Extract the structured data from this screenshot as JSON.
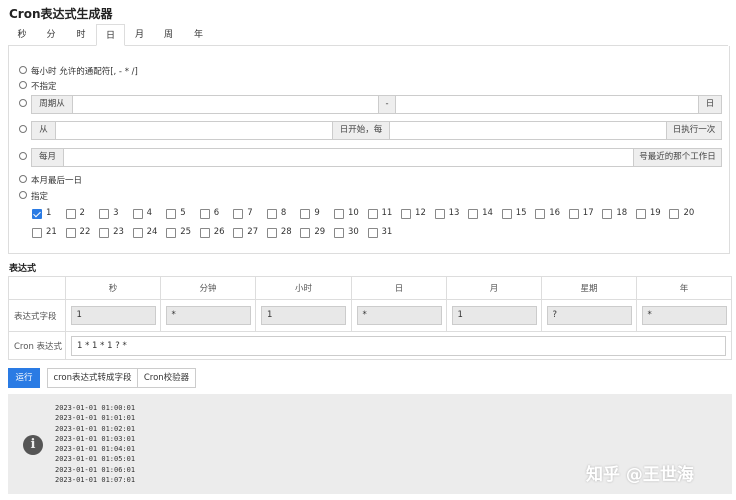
{
  "app_title": "Cron表达式生成器",
  "tabs": [
    "秒",
    "分",
    "时",
    "日",
    "月",
    "周",
    "年"
  ],
  "active_tab": "日",
  "day_options": {
    "every": "每小时 允许的通配符[, - * /]",
    "unspecified": "不指定",
    "period": {
      "prefix": "周期从",
      "separator": "-",
      "suffix": "日"
    },
    "from": {
      "prefix": "从",
      "middle": "日开始，每",
      "suffix": "日执行一次"
    },
    "monthly": {
      "prefix": "每月",
      "suffix": "号最近的那个工作日"
    },
    "last_day": "本月最后一日",
    "specify": "指定"
  },
  "days": [
    "1",
    "2",
    "3",
    "4",
    "5",
    "6",
    "7",
    "8",
    "9",
    "10",
    "11",
    "12",
    "13",
    "14",
    "15",
    "16",
    "17",
    "18",
    "19",
    "20",
    "21",
    "22",
    "23",
    "24",
    "25",
    "26",
    "27",
    "28",
    "29",
    "30",
    "31"
  ],
  "checked_days": [
    "1"
  ],
  "expression": {
    "section_title": "表达式",
    "columns": [
      "秒",
      "分钟",
      "小时",
      "日",
      "月",
      "星期",
      "年"
    ],
    "field_row_label": "表达式字段",
    "field_values": [
      "1",
      "*",
      "1",
      "*",
      "1",
      "?",
      "*"
    ],
    "cron_row_label": "Cron 表达式",
    "cron_value": "1 * 1 * 1 ? *"
  },
  "buttons": {
    "run": "运行",
    "to_fields": "cron表达式转成字段",
    "validator": "Cron校验器"
  },
  "colors": {
    "accent": "#2a7be4",
    "result_bg": "#ececec"
  },
  "result_icon": "info-icon",
  "run_results": [
    "2023-01-01 01:00:01",
    "2023-01-01 01:01:01",
    "2023-01-01 01:02:01",
    "2023-01-01 01:03:01",
    "2023-01-01 01:04:01",
    "2023-01-01 01:05:01",
    "2023-01-01 01:06:01",
    "2023-01-01 01:07:01"
  ],
  "watermark": "知乎 @王世海"
}
